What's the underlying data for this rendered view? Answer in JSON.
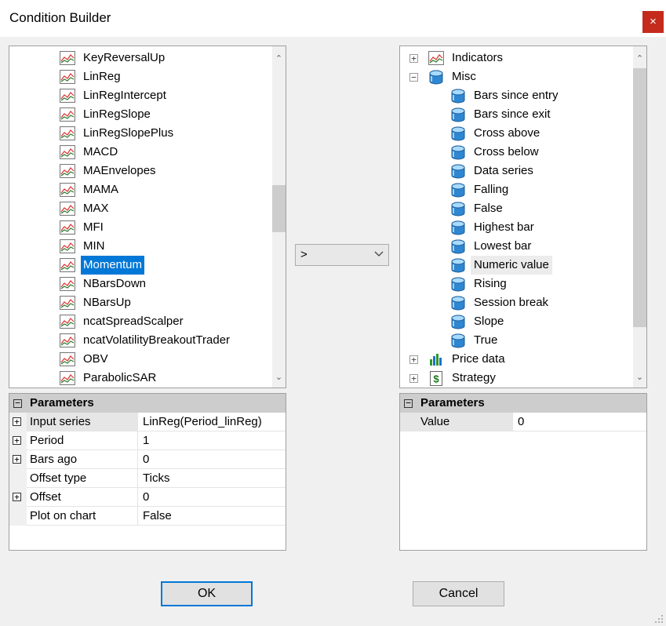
{
  "window": {
    "title": "Condition Builder",
    "close_glyph": "×"
  },
  "left_list": {
    "items": [
      {
        "label": "KeyReversalUp",
        "icon": "indicator-chart-icon"
      },
      {
        "label": "LinReg",
        "icon": "indicator-chart-icon"
      },
      {
        "label": "LinRegIntercept",
        "icon": "indicator-chart-icon"
      },
      {
        "label": "LinRegSlope",
        "icon": "indicator-chart-icon"
      },
      {
        "label": "LinRegSlopePlus",
        "icon": "indicator-chart-icon"
      },
      {
        "label": "MACD",
        "icon": "indicator-chart-icon"
      },
      {
        "label": "MAEnvelopes",
        "icon": "indicator-chart-icon"
      },
      {
        "label": "MAMA",
        "icon": "indicator-chart-icon"
      },
      {
        "label": "MAX",
        "icon": "indicator-chart-icon"
      },
      {
        "label": "MFI",
        "icon": "indicator-chart-icon"
      },
      {
        "label": "MIN",
        "icon": "indicator-chart-icon"
      },
      {
        "label": "Momentum",
        "icon": "indicator-chart-icon",
        "selected": true
      },
      {
        "label": "NBarsDown",
        "icon": "indicator-chart-icon"
      },
      {
        "label": "NBarsUp",
        "icon": "indicator-chart-icon"
      },
      {
        "label": "ncatSpreadScalper",
        "icon": "indicator-chart-icon"
      },
      {
        "label": "ncatVolatilityBreakoutTrader",
        "icon": "indicator-chart-icon"
      },
      {
        "label": "OBV",
        "icon": "indicator-chart-icon"
      },
      {
        "label": "ParabolicSAR",
        "icon": "indicator-chart-icon"
      }
    ],
    "scroll_up_glyph": "⌃",
    "scroll_down_glyph": "⌄"
  },
  "operator": {
    "selected": ">",
    "chevron_glyph": "⌄"
  },
  "right_tree": {
    "nodes": [
      {
        "label": "Indicators",
        "expander": "+",
        "icon": "indicator-chart-icon",
        "level": 0
      },
      {
        "label": "Misc",
        "expander": "−",
        "icon": "misc-cube-icon",
        "level": 0
      },
      {
        "label": "Bars since entry",
        "icon": "misc-cube-icon",
        "level": 1
      },
      {
        "label": "Bars since exit",
        "icon": "misc-cube-icon",
        "level": 1
      },
      {
        "label": "Cross above",
        "icon": "misc-cube-icon",
        "level": 1
      },
      {
        "label": "Cross below",
        "icon": "misc-cube-icon",
        "level": 1
      },
      {
        "label": "Data series",
        "icon": "misc-cube-icon",
        "level": 1
      },
      {
        "label": "Falling",
        "icon": "misc-cube-icon",
        "level": 1
      },
      {
        "label": "False",
        "icon": "misc-cube-icon",
        "level": 1
      },
      {
        "label": "Highest bar",
        "icon": "misc-cube-icon",
        "level": 1
      },
      {
        "label": "Lowest bar",
        "icon": "misc-cube-icon",
        "level": 1
      },
      {
        "label": "Numeric value",
        "icon": "misc-cube-icon",
        "level": 1,
        "highlighted": true
      },
      {
        "label": "Rising",
        "icon": "misc-cube-icon",
        "level": 1
      },
      {
        "label": "Session break",
        "icon": "misc-cube-icon",
        "level": 1
      },
      {
        "label": "Slope",
        "icon": "misc-cube-icon",
        "level": 1
      },
      {
        "label": "True",
        "icon": "misc-cube-icon",
        "level": 1
      },
      {
        "label": "Price data",
        "expander": "+",
        "icon": "price-bars-icon",
        "level": 0
      },
      {
        "label": "Strategy",
        "expander": "+",
        "icon": "strategy-dollar-icon",
        "level": 0
      }
    ]
  },
  "left_params": {
    "header": "Parameters",
    "rows": [
      {
        "name": "Input series",
        "value": "LinReg(Period_linReg)",
        "expandable": true,
        "shaded": true
      },
      {
        "name": "Period",
        "value": "1",
        "expandable": true
      },
      {
        "name": "Bars ago",
        "value": "0",
        "expandable": true
      },
      {
        "name": "Offset type",
        "value": "Ticks",
        "expandable": false
      },
      {
        "name": "Offset",
        "value": "0",
        "expandable": true
      },
      {
        "name": "Plot on chart",
        "value": "False",
        "expandable": false
      }
    ]
  },
  "right_params": {
    "header": "Parameters",
    "rows": [
      {
        "name": "Value",
        "value": "0"
      }
    ]
  },
  "buttons": {
    "ok": "OK",
    "cancel": "Cancel"
  },
  "colors": {
    "selection": "#0078d7",
    "close": "#c42b1c",
    "header_bg": "#cdcdcd"
  }
}
